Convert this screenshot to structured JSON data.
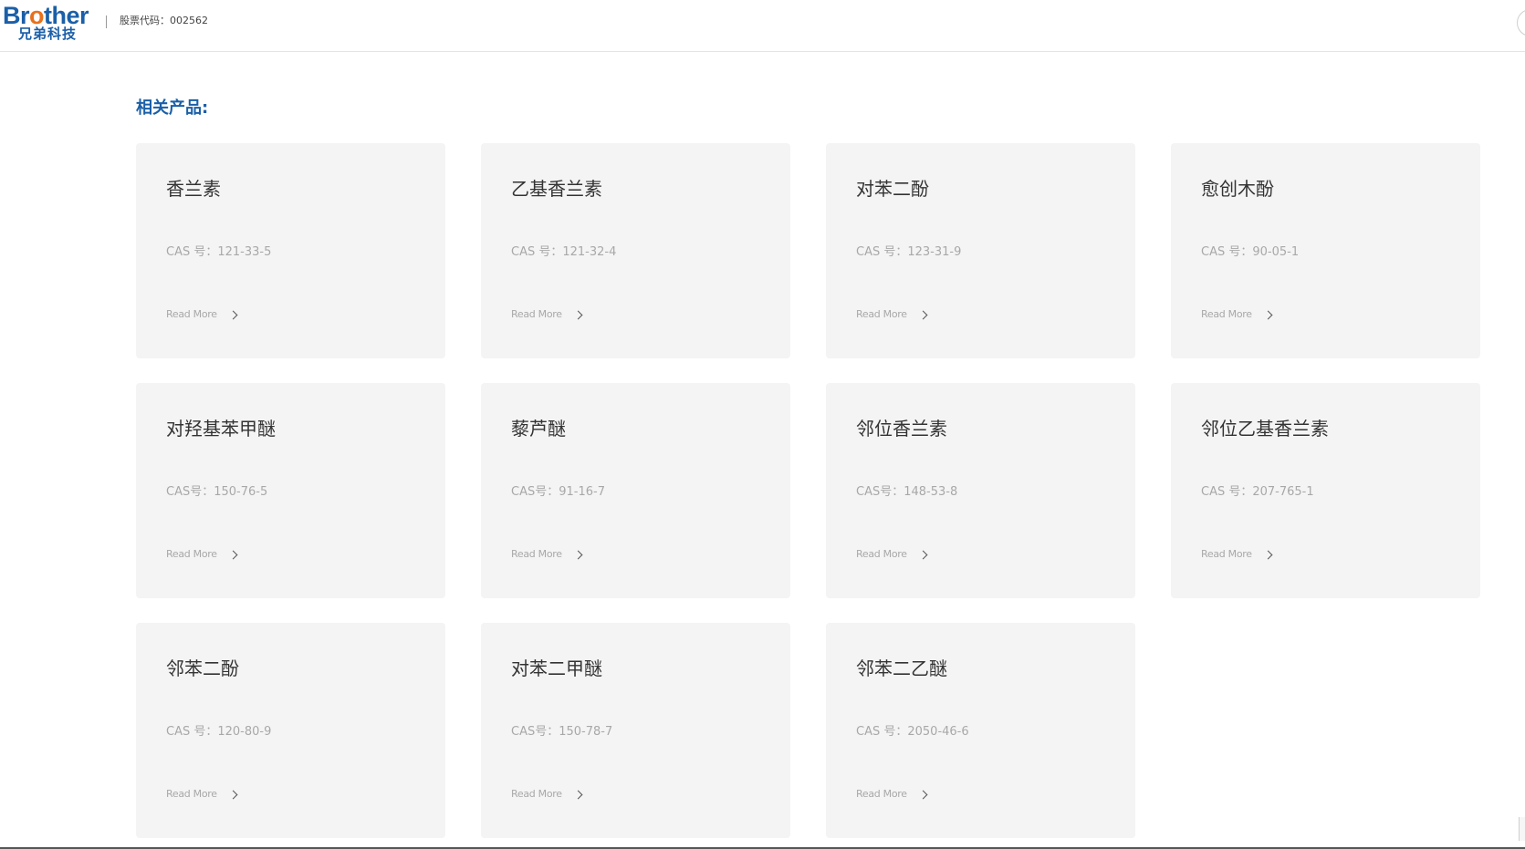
{
  "header": {
    "logo_en_prefix": "Br",
    "logo_en_o": "o",
    "logo_en_suffix": "ther",
    "logo_cn": "兄弟科技",
    "stock_code": "股票代码：002562"
  },
  "section": {
    "title": "相关产品:"
  },
  "products": [
    {
      "name": "香兰素",
      "cas": "CAS 号：121-33-5",
      "more": "Read More"
    },
    {
      "name": "乙基香兰素",
      "cas": "CAS 号：121-32-4",
      "more": "Read More"
    },
    {
      "name": "对苯二酚",
      "cas": "CAS 号：123-31-9",
      "more": "Read More"
    },
    {
      "name": "愈创木酚",
      "cas": "CAS 号：90-05-1",
      "more": "Read More"
    },
    {
      "name": "对羟基苯甲醚",
      "cas": "CAS号：150-76-5",
      "more": "Read More"
    },
    {
      "name": "藜芦醚",
      "cas": "CAS号：91-16-7",
      "more": "Read More"
    },
    {
      "name": "邻位香兰素",
      "cas": "CAS号：148-53-8",
      "more": "Read More"
    },
    {
      "name": "邻位乙基香兰素",
      "cas": "CAS 号：207-765-1",
      "more": "Read More"
    },
    {
      "name": "邻苯二酚",
      "cas": "CAS 号：120-80-9",
      "more": "Read More"
    },
    {
      "name": "对苯二甲醚",
      "cas": "CAS号：150-78-7",
      "more": "Read More"
    },
    {
      "name": "邻苯二乙醚",
      "cas": "CAS 号：2050-46-6",
      "more": "Read More"
    }
  ],
  "colors": {
    "brand_blue": "#1a5fa8",
    "brand_orange": "#e8711c",
    "card_bg": "#f4f4f4"
  },
  "icons": {
    "read_more": "chevron-right-icon"
  }
}
